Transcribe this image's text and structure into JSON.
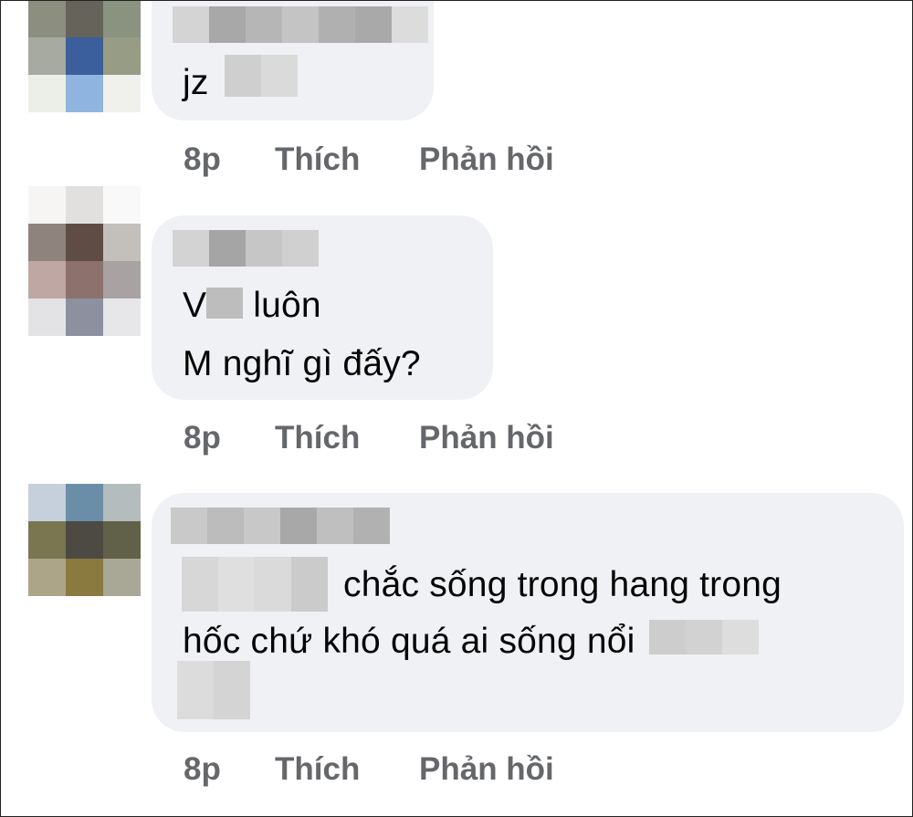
{
  "comments": [
    {
      "lines": [
        "jz"
      ],
      "time": "8p",
      "like_label": "Thích",
      "reply_label": "Phản hồi"
    },
    {
      "lines": [
        "V",
        "luôn",
        "M nghĩ gì đấy?"
      ],
      "time": "8p",
      "like_label": "Thích",
      "reply_label": "Phản hồi"
    },
    {
      "lines": [
        "chắc sống trong hang trong",
        "hốc chứ khó quá ai sống nổi"
      ],
      "time": "8p",
      "like_label": "Thích",
      "reply_label": "Phản hồi"
    }
  ]
}
